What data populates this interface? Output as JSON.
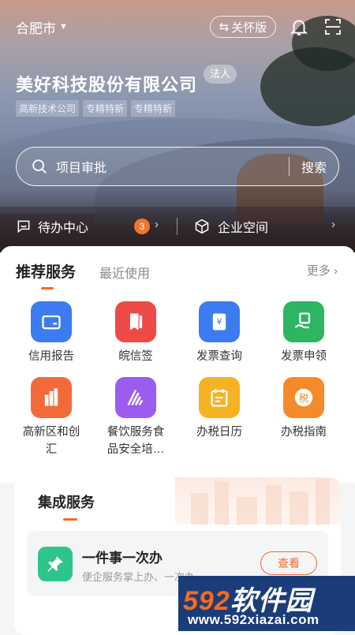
{
  "header": {
    "city": "合肥市",
    "care_mode": "关怀版",
    "company_name": "美好科技股份有限公司",
    "legal_tag": "法人",
    "tags": [
      "高新技术公司",
      "专精特新",
      "专精特新"
    ]
  },
  "search": {
    "query": "项目审批",
    "button": "搜索"
  },
  "quickbar": {
    "todo": "待办中心",
    "todo_count": "3",
    "space": "企业空间"
  },
  "services": {
    "tab_active": "推荐服务",
    "tab_other": "最近使用",
    "more": "更多",
    "items": [
      {
        "label": "信用报告",
        "icon": "credit-card-icon",
        "color": "#3d7cf0"
      },
      {
        "label": "皖信签",
        "icon": "bookmark-icon",
        "color": "#ee4a48"
      },
      {
        "label": "发票查询",
        "icon": "invoice-icon",
        "color": "#3d7cf0"
      },
      {
        "label": "发票申领",
        "icon": "hand-invoice-icon",
        "color": "#2db561"
      },
      {
        "label": "高新区和创\n汇",
        "icon": "building-icon",
        "color": "#f36a3a"
      },
      {
        "label": "餐饮服务食\n品安全培…",
        "icon": "stripes-icon",
        "color": "#9b5cf0"
      },
      {
        "label": "办税日历",
        "icon": "calendar-icon",
        "color": "#f5b324"
      },
      {
        "label": "办税指南",
        "icon": "tax-guide-icon",
        "color": "#f58a2a"
      }
    ]
  },
  "integrated": {
    "title": "集成服务",
    "item_title": "一件事一次办",
    "item_desc": "便企服务掌上办、一次办",
    "item_button": "查看"
  },
  "watermark": {
    "brand_num": "592",
    "brand_cn": "软件园",
    "url": "www.592xiazai.com"
  }
}
